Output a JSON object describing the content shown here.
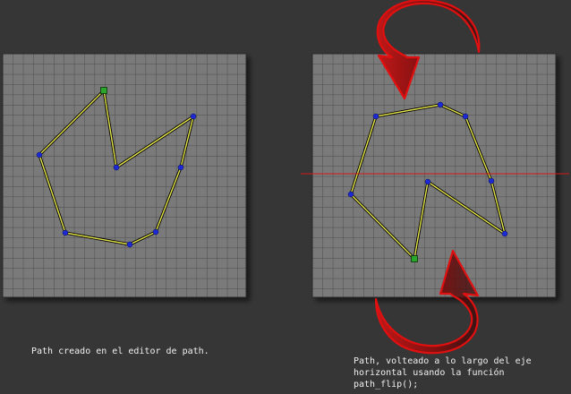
{
  "captions": {
    "left": "Path creado en el editor de path.",
    "right": "Path, volteado a lo largo del eje horizontal usando la función path_flip();"
  },
  "colors": {
    "background": "#363636",
    "grid_fill": "#7a7a7a",
    "grid_line": "#4a4a4a",
    "path_line": "#e6e64a",
    "point": "#1c2ad6",
    "start_point": "#2aa62a",
    "axis_line": "#d01818",
    "arrow": "#b01010"
  },
  "icons": [
    "flip-arrow-icon"
  ]
}
